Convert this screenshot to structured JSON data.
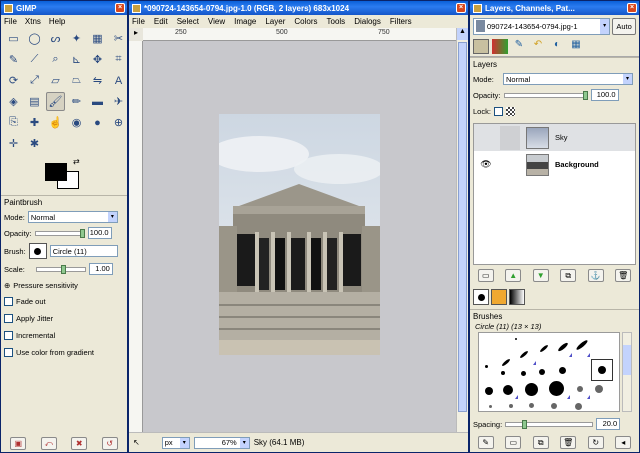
{
  "toolbox": {
    "title": "GIMP",
    "menu": [
      "File",
      "Xtns",
      "Help"
    ],
    "tools": [
      {
        "name": "rect-select-icon",
        "glyph": "▭"
      },
      {
        "name": "ellipse-select-icon",
        "glyph": "◯"
      },
      {
        "name": "free-select-icon",
        "glyph": "ᔕ"
      },
      {
        "name": "fuzzy-select-icon",
        "glyph": "✦"
      },
      {
        "name": "select-by-color-icon",
        "glyph": "▦"
      },
      {
        "name": "scissors-icon",
        "glyph": "✂"
      },
      {
        "name": "paths-icon",
        "glyph": "✎"
      },
      {
        "name": "color-picker-icon",
        "glyph": "⟋"
      },
      {
        "name": "zoom-icon",
        "glyph": "⌕"
      },
      {
        "name": "measure-icon",
        "glyph": "⊾"
      },
      {
        "name": "move-icon",
        "glyph": "✥"
      },
      {
        "name": "crop-icon",
        "glyph": "⌗"
      },
      {
        "name": "rotate-icon",
        "glyph": "⟳"
      },
      {
        "name": "scale-icon",
        "glyph": "⤢"
      },
      {
        "name": "shear-icon",
        "glyph": "▱"
      },
      {
        "name": "perspective-icon",
        "glyph": "⏢"
      },
      {
        "name": "flip-icon",
        "glyph": "⇋"
      },
      {
        "name": "text-icon",
        "glyph": "A"
      },
      {
        "name": "bucket-fill-icon",
        "glyph": "◈"
      },
      {
        "name": "blend-icon",
        "glyph": "▤"
      },
      {
        "name": "paintbrush-icon",
        "glyph": "🖌"
      },
      {
        "name": "pencil-icon",
        "glyph": "✏"
      },
      {
        "name": "eraser-icon",
        "glyph": "▬"
      },
      {
        "name": "airbrush-icon",
        "glyph": "✈"
      },
      {
        "name": "clone-icon",
        "glyph": "⎘"
      },
      {
        "name": "heal-icon",
        "glyph": "✚"
      },
      {
        "name": "smudge-icon",
        "glyph": "☝"
      },
      {
        "name": "convolve-icon",
        "glyph": "◉"
      },
      {
        "name": "dodge-burn-icon",
        "glyph": "●"
      },
      {
        "name": "magnify-icon",
        "glyph": "⊕"
      },
      {
        "name": "align-icon",
        "glyph": "✛"
      },
      {
        "name": "ink-icon",
        "glyph": "✱"
      }
    ],
    "active_tool_index": 20,
    "fg_color": "#000000",
    "bg_color": "#ffffff",
    "tool_options": {
      "title": "Paintbrush",
      "mode_label": "Mode:",
      "mode_value": "Normal",
      "opacity_label": "Opacity:",
      "opacity_value": "100.0",
      "brush_label": "Brush:",
      "brush_value": "Circle (11)",
      "scale_label": "Scale:",
      "scale_value": "1.00",
      "pressure_label": "Pressure sensitivity",
      "fade_label": "Fade out",
      "jitter_label": "Apply Jitter",
      "incremental_label": "Incremental",
      "gradient_label": "Use color from gradient"
    }
  },
  "image_window": {
    "title": "*090724-143654-0794.jpg-1.0 (RGB, 2 layers) 683x1024",
    "menu": [
      "File",
      "Edit",
      "Select",
      "View",
      "Image",
      "Layer",
      "Colors",
      "Tools",
      "Dialogs",
      "Filters"
    ],
    "ruler_ticks": [
      "250",
      "500",
      "750"
    ],
    "unit": "px",
    "zoom": "67%",
    "status": "Sky (64.1 MB)"
  },
  "layers_window": {
    "title": "Layers, Channels, Pat...",
    "image_select": "090724-143654-0794.jpg-1",
    "auto_label": "Auto",
    "panel_title": "Layers",
    "mode_label": "Mode:",
    "mode_value": "Normal",
    "opacity_label": "Opacity:",
    "opacity_value": "100.0",
    "lock_label": "Lock:",
    "layers": [
      {
        "name": "Sky",
        "visible": false
      },
      {
        "name": "Background",
        "visible": true
      }
    ],
    "brushes_title": "Brushes",
    "brush_info": "Circle (11) (13 × 13)",
    "spacing_label": "Spacing:",
    "spacing_value": "20.0"
  }
}
